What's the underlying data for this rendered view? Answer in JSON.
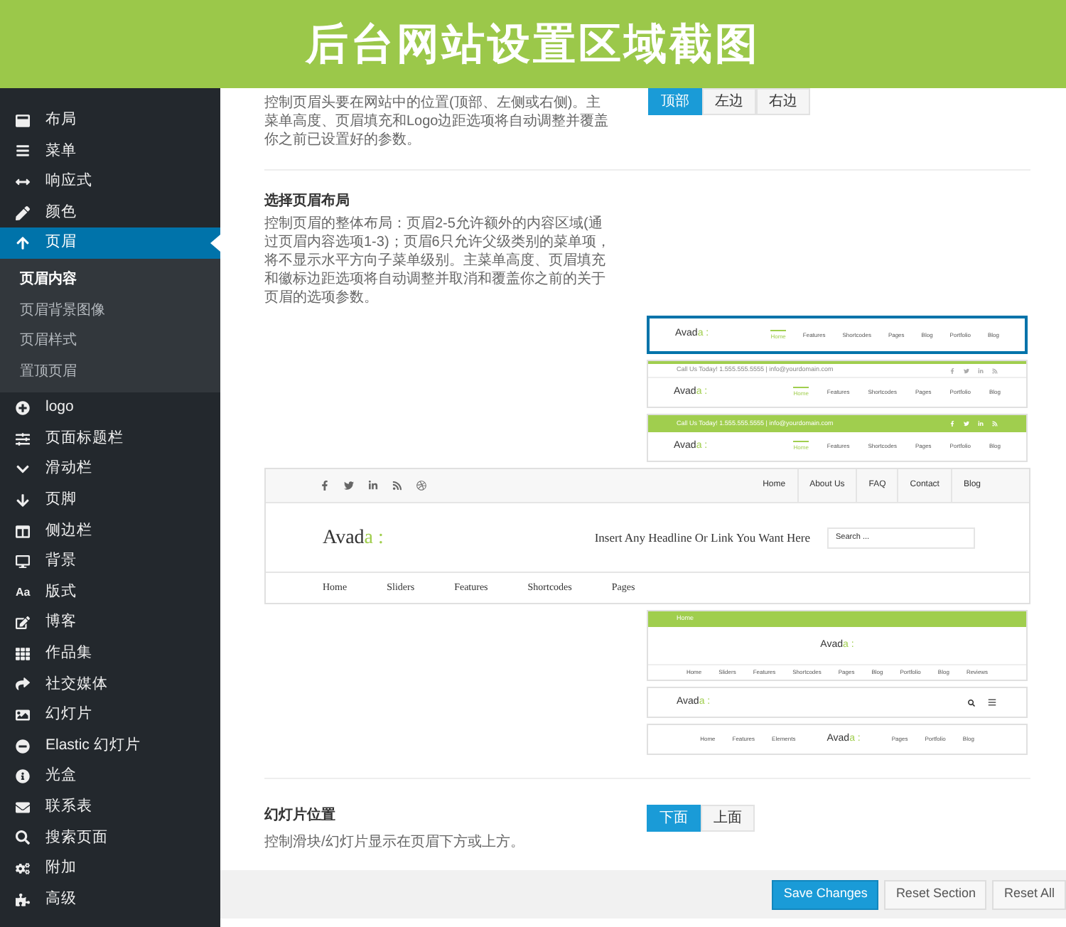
{
  "banner": {
    "title": "后台网站设置区域截图"
  },
  "sidebar": {
    "items": [
      {
        "label": "布局",
        "selected": false
      },
      {
        "label": "菜单",
        "selected": false
      },
      {
        "label": "响应式",
        "selected": false
      },
      {
        "label": "颜色",
        "selected": false
      },
      {
        "label": "页眉",
        "selected": true,
        "children": [
          {
            "label": "页眉内容",
            "selected": true
          },
          {
            "label": "页眉背景图像",
            "selected": false
          },
          {
            "label": "页眉样式",
            "selected": false
          },
          {
            "label": "置顶页眉",
            "selected": false
          }
        ]
      },
      {
        "label": "logo",
        "selected": false
      },
      {
        "label": "页面标题栏",
        "selected": false
      },
      {
        "label": "滑动栏",
        "selected": false
      },
      {
        "label": "页脚",
        "selected": false
      },
      {
        "label": "侧边栏",
        "selected": false
      },
      {
        "label": "背景",
        "selected": false
      },
      {
        "label": "版式",
        "selected": false,
        "icon_text": "Aa"
      },
      {
        "label": "博客",
        "selected": false
      },
      {
        "label": "作品集",
        "selected": false
      },
      {
        "label": "社交媒体",
        "selected": false
      },
      {
        "label": "幻灯片",
        "selected": false
      },
      {
        "label": "Elastic 幻灯片",
        "selected": false
      },
      {
        "label": "光盒",
        "selected": false
      },
      {
        "label": "联系表",
        "selected": false
      },
      {
        "label": "搜索页面",
        "selected": false
      },
      {
        "label": "附加",
        "selected": false
      },
      {
        "label": "高级",
        "selected": false
      }
    ]
  },
  "header_position": {
    "description": "控制页眉头要在网站中的位置(顶部、左侧或右侧)。主菜单高度、页眉填充和Logo边距选项将自动调整并覆盖你之前已设置好的参数。",
    "options": [
      {
        "label": "顶部",
        "selected": true
      },
      {
        "label": "左边",
        "selected": false
      },
      {
        "label": "右边",
        "selected": false
      }
    ]
  },
  "header_layout": {
    "title": "选择页眉布局",
    "description": "控制页眉的整体布局：页眉2-5允许额外的内容区域(通过页眉内容选项1-3)；页眉6只允许父级类别的菜单项，将不显示水平方向子菜单级别。主菜单高度、页眉填充和徽标边距选项将自动调整并取消和覆盖你之前的关于页眉的选项参数。",
    "layouts": [
      {
        "kind": "classic",
        "selected": true,
        "logo": {
          "main": "Avad",
          "accent": "a :"
        },
        "nav": [
          {
            "label": "Home",
            "selected": true
          },
          {
            "label": "Features",
            "selected": false
          },
          {
            "label": "Shortcodes",
            "selected": false
          },
          {
            "label": "Pages",
            "selected": false
          },
          {
            "label": "Blog",
            "selected": false
          },
          {
            "label": "Portfolio",
            "selected": false
          },
          {
            "label": "Blog",
            "selected": false
          }
        ]
      },
      {
        "kind": "topbar_light",
        "selected": false,
        "contact": "Call Us Today! 1.555.555.5555 | info@yourdomain.com",
        "logo": {
          "main": "Avad",
          "accent": "a :"
        },
        "nav": [
          {
            "label": "Home",
            "selected": true
          },
          {
            "label": "Features",
            "selected": false
          },
          {
            "label": "Shortcodes",
            "selected": false
          },
          {
            "label": "Pages",
            "selected": false
          },
          {
            "label": "Portfolio",
            "selected": false
          },
          {
            "label": "Blog",
            "selected": false
          }
        ]
      },
      {
        "kind": "topbar_green",
        "selected": false,
        "contact": "Call Us Today! 1.555.555.5555 | info@yourdomain.com",
        "logo": {
          "main": "Avad",
          "accent": "a :"
        },
        "nav": [
          {
            "label": "Home",
            "selected": true
          },
          {
            "label": "Features",
            "selected": false
          },
          {
            "label": "Shortcodes",
            "selected": false
          },
          {
            "label": "Pages",
            "selected": false
          },
          {
            "label": "Portfolio",
            "selected": false
          },
          {
            "label": "Blog",
            "selected": false
          }
        ]
      },
      {
        "kind": "full",
        "selected": false,
        "top_menu": [
          "Home",
          "About Us",
          "FAQ",
          "Contact",
          "Blog"
        ],
        "logo": {
          "main": "Avad",
          "accent": "a :"
        },
        "headline": "Insert Any Headline Or Link You Want Here",
        "search": {
          "placeholder": "Search ..."
        },
        "nav": [
          {
            "label": "Home",
            "selected": false
          },
          {
            "label": "Sliders",
            "selected": false
          },
          {
            "label": "Features",
            "selected": false
          },
          {
            "label": "Shortcodes",
            "selected": false
          },
          {
            "label": "Pages",
            "selected": false
          }
        ]
      },
      {
        "kind": "centered",
        "selected": false,
        "top_menu": [
          "Home"
        ],
        "logo": {
          "main": "Avad",
          "accent": "a :"
        },
        "nav": [
          {
            "label": "Home",
            "selected": false
          },
          {
            "label": "Sliders",
            "selected": false
          },
          {
            "label": "Features",
            "selected": false
          },
          {
            "label": "Shortcodes",
            "selected": false
          },
          {
            "label": "Pages",
            "selected": false
          },
          {
            "label": "Blog",
            "selected": false
          },
          {
            "label": "Portfolio",
            "selected": false
          },
          {
            "label": "Blog",
            "selected": false
          },
          {
            "label": "Reviews",
            "selected": false
          }
        ]
      },
      {
        "kind": "mobile",
        "selected": false,
        "logo": {
          "main": "Avad",
          "accent": "a :"
        }
      },
      {
        "kind": "split",
        "selected": false,
        "logo": {
          "main": "Avad",
          "accent": "a :"
        },
        "nav_left": [
          "Home",
          "Features",
          "Elements"
        ],
        "nav_right": [
          "Pages",
          "Portfolio",
          "Blog"
        ]
      }
    ]
  },
  "slider_position": {
    "title": "幻灯片位置",
    "description": "控制滑块/幻灯片显示在页眉下方或上方。",
    "options": [
      {
        "label": "下面",
        "selected": true
      },
      {
        "label": "上面",
        "selected": false
      }
    ]
  },
  "footer": {
    "buttons": [
      {
        "label": "Save Changes",
        "kind": "primary"
      },
      {
        "label": "Reset Section",
        "kind": "secondary"
      },
      {
        "label": "Reset All",
        "kind": "secondary"
      }
    ]
  }
}
